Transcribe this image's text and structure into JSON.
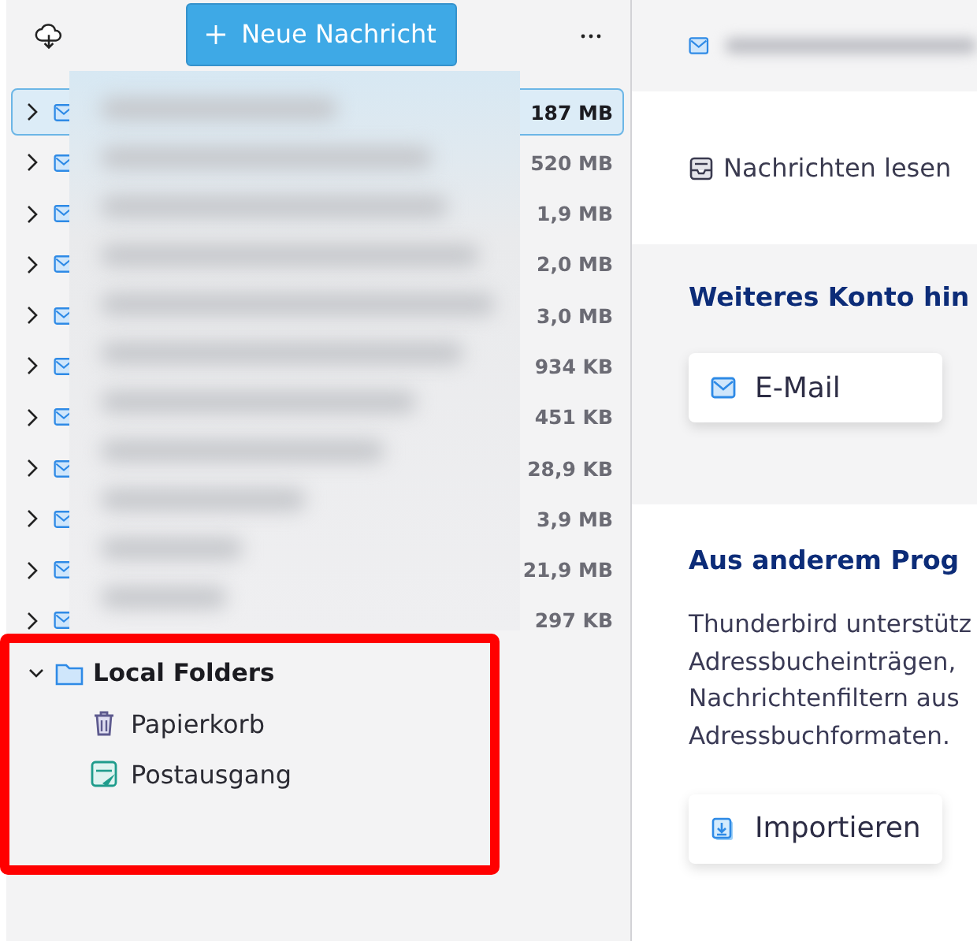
{
  "toolbar": {
    "new_message_button": "Neue Nachricht"
  },
  "accounts": [
    {
      "size": "187 MB",
      "selected": true,
      "expanded": false
    },
    {
      "size": "520 MB",
      "selected": false,
      "expanded": false
    },
    {
      "size": "1,9 MB",
      "selected": false,
      "expanded": false
    },
    {
      "size": "2,0 MB",
      "selected": false,
      "expanded": false
    },
    {
      "size": "3,0 MB",
      "selected": false,
      "expanded": false
    },
    {
      "size": "934 KB",
      "selected": false,
      "expanded": false
    },
    {
      "size": "451 KB",
      "selected": false,
      "expanded": false
    },
    {
      "size": "28,9 KB",
      "selected": false,
      "expanded": false
    },
    {
      "size": "3,9 MB",
      "selected": false,
      "expanded": false
    },
    {
      "size": "21,9 MB",
      "selected": false,
      "expanded": false
    },
    {
      "size": "297 KB",
      "selected": false,
      "expanded": false
    }
  ],
  "local_folders": {
    "label": "Local Folders",
    "expanded": true,
    "children": [
      {
        "label": "Papierkorb",
        "kind": "trash"
      },
      {
        "label": "Postausgang",
        "kind": "outbox"
      }
    ]
  },
  "main": {
    "read_messages": "Nachrichten lesen",
    "add_account": {
      "heading": "Weiteres Konto hin",
      "buttons": [
        "E-Mail"
      ]
    },
    "import": {
      "heading": "Aus anderem Prog",
      "lines": [
        "Thunderbird unterstütz",
        "Adressbucheinträgen,",
        "Nachrichtenfiltern aus",
        "Adressbuchformaten."
      ],
      "button": "Importieren"
    }
  }
}
